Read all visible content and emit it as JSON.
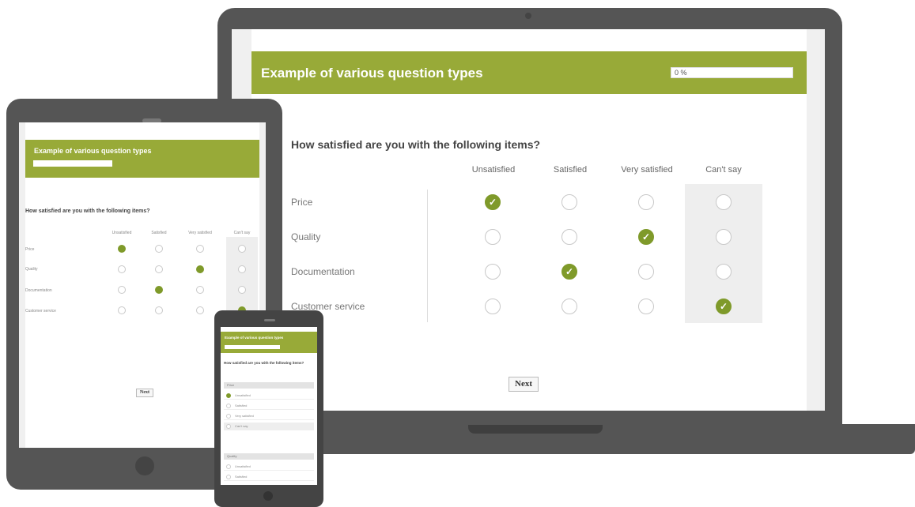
{
  "laptop": {
    "survey_title": "Example of various question types",
    "progress_label": "0 %",
    "progress": 0,
    "question": "How satisfied are you with the following items?",
    "columns": [
      "Unsatisfied",
      "Satisfied",
      "Very satisfied",
      "Can't say"
    ],
    "rows": [
      "Price",
      "Quality",
      "Documentation",
      "Customer service"
    ],
    "next_label": "Next"
  },
  "tablet": {
    "survey_title": "Example of various question types",
    "question": "How satisfied are you with the following items?",
    "columns": [
      "Unsatisfied",
      "Satisfied",
      "Very satisfied",
      "Can't say"
    ],
    "rows": [
      "Price",
      "Quality",
      "Documentation",
      "Customer service"
    ],
    "next_label": "Next"
  },
  "phone": {
    "survey_title": "Example of various question types",
    "question": "How satisfied are you with the following items?",
    "groups": [
      "Price",
      "Quality"
    ],
    "options": [
      "Unsatisfied",
      "Satisfied",
      "Very satisfied",
      "Can't say"
    ]
  },
  "colors": {
    "accent": "#98aa38",
    "check": "#7f9a2a"
  }
}
